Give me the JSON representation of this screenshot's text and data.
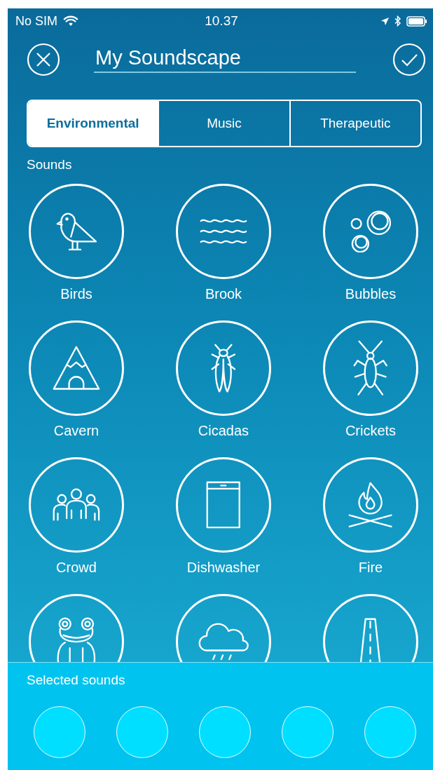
{
  "status_bar": {
    "carrier": "No SIM",
    "time": "10.37"
  },
  "header": {
    "title_value": "My Soundscape"
  },
  "tabs": [
    {
      "label": "Environmental",
      "selected": true
    },
    {
      "label": "Music",
      "selected": false
    },
    {
      "label": "Therapeutic",
      "selected": false
    }
  ],
  "sounds_heading": "Sounds",
  "sounds": [
    {
      "kind": "sound",
      "name": "Birds"
    },
    {
      "kind": "sound",
      "name": "Brook"
    },
    {
      "kind": "sound",
      "name": "Bubbles"
    },
    {
      "kind": "sound",
      "name": "Cavern"
    },
    {
      "kind": "sound",
      "name": "Cicadas"
    },
    {
      "kind": "sound",
      "name": "Crickets"
    },
    {
      "kind": "sound",
      "name": "Crowd"
    },
    {
      "kind": "sound",
      "name": "Dishwasher"
    },
    {
      "kind": "sound",
      "name": "Fire"
    },
    {
      "kind": "sound"
    },
    {
      "kind": "sound"
    },
    {
      "kind": "sound"
    }
  ],
  "selected_sounds": {
    "heading": "Selected sounds",
    "slots": [
      {
        "kind": "empty"
      },
      {
        "kind": "empty"
      },
      {
        "kind": "empty"
      },
      {
        "kind": "empty"
      },
      {
        "kind": "empty"
      }
    ]
  }
}
